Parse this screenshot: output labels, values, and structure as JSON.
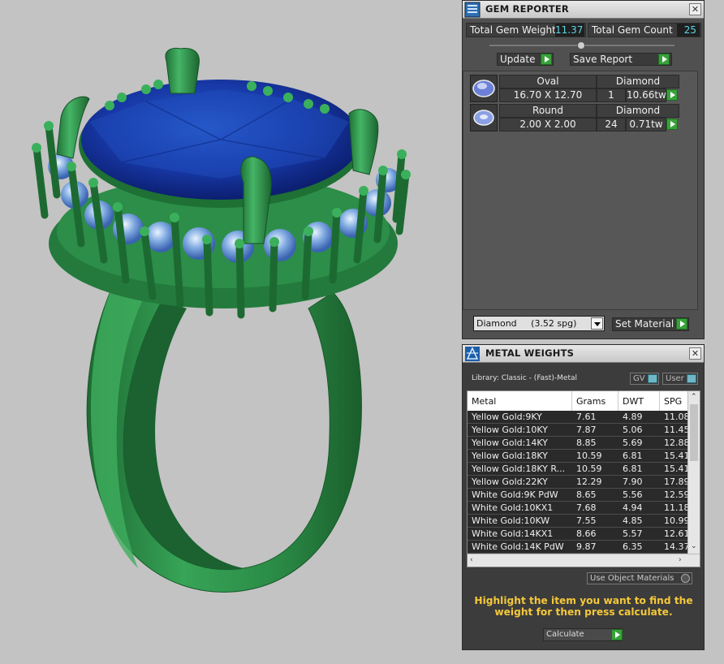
{
  "gem_reporter": {
    "title": "GEM REPORTER",
    "icon": "gem-reporter-icon",
    "close": "✕",
    "total_gem_weight_label": "Total Gem Weight",
    "total_gem_weight": "11.37",
    "total_gem_count_label": "Total Gem Count",
    "total_gem_count": "25",
    "update_label": "Update",
    "save_report_label": "Save Report",
    "gems": [
      {
        "shape": "Oval",
        "material": "Diamond",
        "size": "16.70 X 12.70",
        "count": "1",
        "weight": "10.66tw"
      },
      {
        "shape": "Round",
        "material": "Diamond",
        "size": "2.00 X 2.00",
        "count": "24",
        "weight": "0.71tw"
      }
    ],
    "material_select": "Diamond     (3.52 spg)",
    "set_material_label": "Set Material"
  },
  "metal_weights": {
    "title": "METAL WEIGHTS",
    "icon": "metal-weights-icon",
    "close": "✕",
    "library": "Library: Classic - (Fast)-Metal",
    "toggle_gv": "GV",
    "toggle_user": "User",
    "columns": [
      "Metal",
      "Grams",
      "DWT",
      "SPG"
    ],
    "rows": [
      {
        "metal": "Yellow Gold:9KY",
        "grams": "7.61",
        "dwt": "4.89",
        "spg": "11.08"
      },
      {
        "metal": "Yellow Gold:10KY",
        "grams": "7.87",
        "dwt": "5.06",
        "spg": "11.45"
      },
      {
        "metal": "Yellow Gold:14KY",
        "grams": "8.85",
        "dwt": "5.69",
        "spg": "12.88"
      },
      {
        "metal": "Yellow Gold:18KY",
        "grams": "10.59",
        "dwt": "6.81",
        "spg": "15.41"
      },
      {
        "metal": "Yellow Gold:18KY R...",
        "grams": "10.59",
        "dwt": "6.81",
        "spg": "15.41"
      },
      {
        "metal": "Yellow Gold:22KY",
        "grams": "12.29",
        "dwt": "7.90",
        "spg": "17.89"
      },
      {
        "metal": "White Gold:9K PdW",
        "grams": "8.65",
        "dwt": "5.56",
        "spg": "12.59"
      },
      {
        "metal": "White Gold:10KX1",
        "grams": "7.68",
        "dwt": "4.94",
        "spg": "11.18"
      },
      {
        "metal": "White Gold:10KW",
        "grams": "7.55",
        "dwt": "4.85",
        "spg": "10.99"
      },
      {
        "metal": "White Gold:14KX1",
        "grams": "8.66",
        "dwt": "5.57",
        "spg": "12.61"
      },
      {
        "metal": "White Gold:14K PdW",
        "grams": "9.87",
        "dwt": "6.35",
        "spg": "14.37"
      }
    ],
    "use_object_materials": "Use Object Materials",
    "hint": "Highlight the item you want to find the weight for then press calculate.",
    "calculate_label": "Calculate"
  },
  "colors": {
    "ring_green": "#2e8b45",
    "gem_blue": "#1a3fa8",
    "accent_cyan": "#5bd6e6",
    "hint_yellow": "#f5c83a",
    "button_green": "#38a23a"
  }
}
